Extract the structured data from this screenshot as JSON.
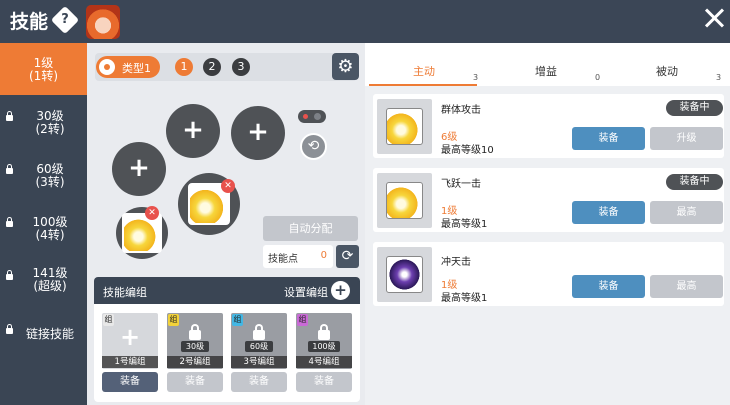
{
  "header": {
    "title": "技能",
    "help_icon": "?"
  },
  "sidebar": {
    "items": [
      {
        "line1": "1级",
        "line2": "(1转)",
        "locked": false
      },
      {
        "line1": "30级",
        "line2": "(2转)",
        "locked": true
      },
      {
        "line1": "60级",
        "line2": "(3转)",
        "locked": true
      },
      {
        "line1": "100级",
        "line2": "(4转)",
        "locked": true
      },
      {
        "line1": "141级",
        "line2": "(超级)",
        "locked": true
      },
      {
        "line1": "链接技能",
        "line2": "",
        "locked": true
      }
    ]
  },
  "slots": {
    "type_label": "类型1",
    "presets": [
      "1",
      "2",
      "3"
    ],
    "preset_colors": [
      "#ee7b35",
      "#3b3d40",
      "#3b3d40"
    ],
    "plus_glyph": "+",
    "remove_glyph": "✕",
    "settings_glyph": "⚙",
    "auto_assign": "自动分配",
    "points_label": "技能点",
    "points_value": "0",
    "refresh_glyph": "⟳",
    "rotate_glyph": "⟲"
  },
  "skill_groups": {
    "title": "技能编组",
    "settings_label": "设置编组",
    "plus_glyph": "+",
    "cards": [
      {
        "tag": "组",
        "tag_color": "#e8e8e8",
        "name": "1号编组",
        "level": "",
        "locked": false,
        "button": "装备",
        "active": true
      },
      {
        "tag": "组",
        "tag_color": "#f2d23a",
        "name": "2号编组",
        "level": "30级",
        "locked": true,
        "button": "装备",
        "active": false
      },
      {
        "tag": "组",
        "tag_color": "#43b7e4",
        "name": "3号编组",
        "level": "60级",
        "locked": true,
        "button": "装备",
        "active": false
      },
      {
        "tag": "组",
        "tag_color": "#c96ad6",
        "name": "4号编组",
        "level": "100级",
        "locked": true,
        "button": "装备",
        "active": false
      }
    ]
  },
  "tabs": [
    {
      "label": "主动",
      "count": "3",
      "active": true
    },
    {
      "label": "增益",
      "count": "0",
      "active": false
    },
    {
      "label": "被动",
      "count": "3",
      "active": false
    }
  ],
  "skills": [
    {
      "name": "群体攻击",
      "level": "6级",
      "max": "最高等级10",
      "equipped": "装备中",
      "btn1": "装备",
      "btn2": "升级",
      "icon": "yellow-slash-icon"
    },
    {
      "name": "飞跃一击",
      "level": "1级",
      "max": "最高等级1",
      "equipped": "装备中",
      "btn1": "装备",
      "btn2": "最高",
      "icon": "yellow-burst-icon"
    },
    {
      "name": "冲天击",
      "level": "1级",
      "max": "最高等级1",
      "equipped": "",
      "btn1": "装备",
      "btn2": "最高",
      "icon": "purple-strike-icon"
    }
  ]
}
